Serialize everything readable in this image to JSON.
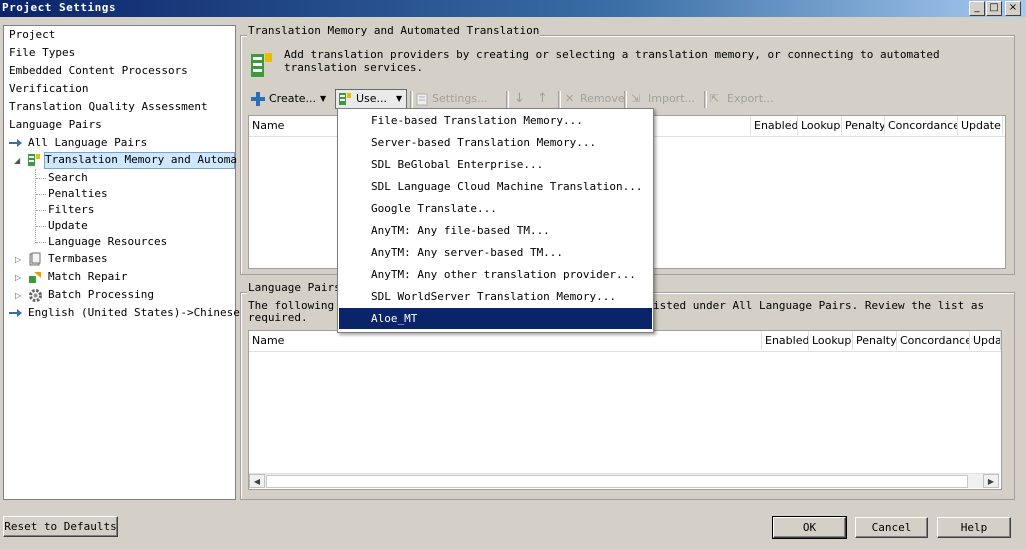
{
  "window": {
    "title": "Project Settings",
    "min_glyph": "_",
    "max_glyph": "□",
    "close_glyph": "×"
  },
  "tree": {
    "items": [
      {
        "label": "Project"
      },
      {
        "label": "File Types"
      },
      {
        "label": "Embedded Content Processors"
      },
      {
        "label": "Verification"
      },
      {
        "label": "Translation Quality Assessment"
      },
      {
        "label": "Language Pairs"
      },
      {
        "label": "All Language Pairs"
      },
      {
        "label": "Translation Memory and Automa"
      },
      {
        "label": "Search"
      },
      {
        "label": "Penalties"
      },
      {
        "label": "Filters"
      },
      {
        "label": "Update"
      },
      {
        "label": "Language Resources"
      },
      {
        "label": "Termbases"
      },
      {
        "label": "Match Repair"
      },
      {
        "label": "Batch Processing"
      },
      {
        "label": "English (United States)->Chinese"
      }
    ]
  },
  "tm_group": {
    "title": "Translation Memory and Automated Translation",
    "description": "Add translation providers by creating or selecting a translation memory, or connecting to automated translation services."
  },
  "toolbar": {
    "create": "Create...",
    "use": "Use...",
    "settings": "Settings...",
    "remove": "Remove",
    "import": "Import...",
    "export": "Export..."
  },
  "tm_grid": {
    "columns": [
      "Name",
      "Enabled",
      "Lookup",
      "Penalty",
      "Concordance",
      "Update"
    ]
  },
  "use_menu": {
    "items": [
      "File-based Translation Memory...",
      "Server-based Translation Memory...",
      "SDL BeGlobal Enterprise...",
      "SDL Language Cloud Machine Translation...",
      "Google Translate...",
      "AnyTM: Any file-based TM...",
      "AnyTM: Any server-based TM...",
      "AnyTM: Any other translation provider...",
      "SDL WorldServer Translation Memory...",
      "Aloe_MT"
    ],
    "selected": "Aloe_MT"
  },
  "lp_group": {
    "title": "Language Pairs",
    "desc_start": "The following l",
    "desc_end": "isted under All Language Pairs. Review the list as",
    "desc_line2": "required."
  },
  "lp_grid": {
    "columns": [
      "Name",
      "Enabled",
      "Lookup",
      "Penalty",
      "Concordance",
      "Upda"
    ]
  },
  "buttons": {
    "reset": "Reset to Defaults",
    "ok": "OK",
    "cancel": "Cancel",
    "help": "Help"
  },
  "colors": {
    "title_start": "#0a246a",
    "selection": "#0a246a",
    "tree_selection": "#cde8ff"
  }
}
